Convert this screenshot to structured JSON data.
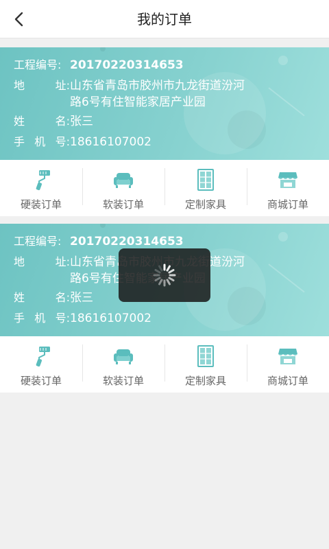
{
  "header": {
    "title": "我的订单",
    "back_icon": "chevron-left-icon"
  },
  "orders": [
    {
      "project_no_label": "工程编号:",
      "project_no": "20170220314653",
      "address_label_1": "地",
      "address_label_2": "址:",
      "address_line1": "山东省青岛市胶州市九龙街道汾河",
      "address_line2": "路6号有住智能家居产业园",
      "name_label_1": "姓",
      "name_label_2": "名:",
      "name": "张三",
      "phone_label_1": "手",
      "phone_label_2": "机",
      "phone_label_3": "号:",
      "phone": "18616107002",
      "actions": [
        {
          "label": "硬装订单",
          "icon": "paint-roller-icon"
        },
        {
          "label": "软装订单",
          "icon": "sofa-icon"
        },
        {
          "label": "定制家具",
          "icon": "wardrobe-icon"
        },
        {
          "label": "商城订单",
          "icon": "store-icon"
        }
      ]
    },
    {
      "project_no_label": "工程编号:",
      "project_no": "20170220314653",
      "address_label_1": "地",
      "address_label_2": "址:",
      "address_line1": "山东省青岛市胶州市九龙街道汾河",
      "address_line2": "路6号有住智能家居产业园",
      "name_label_1": "姓",
      "name_label_2": "名:",
      "name": "张三",
      "phone_label_1": "手",
      "phone_label_2": "机",
      "phone_label_3": "号:",
      "phone": "18616107002",
      "actions": [
        {
          "label": "硬装订单",
          "icon": "paint-roller-icon"
        },
        {
          "label": "软装订单",
          "icon": "sofa-icon"
        },
        {
          "label": "定制家具",
          "icon": "wardrobe-icon"
        },
        {
          "label": "商城订单",
          "icon": "store-icon"
        }
      ]
    }
  ],
  "loading": {
    "icon": "spinner-icon"
  },
  "colors": {
    "card_gradient_start": "#6dc3c2",
    "card_gradient_end": "#9edfdc",
    "icon_accent": "#5bbdbd",
    "toast_bg": "#1a1a1a"
  }
}
